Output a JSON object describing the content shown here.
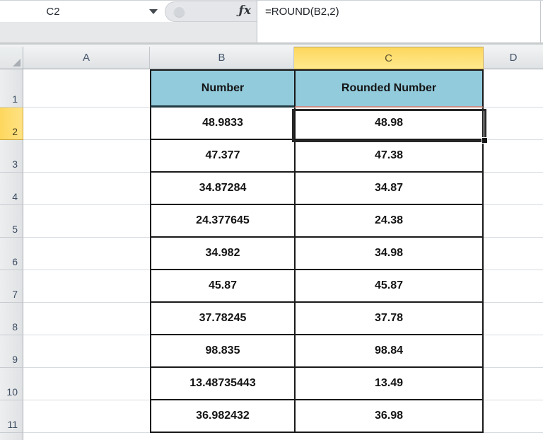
{
  "name_box": {
    "value": "C2"
  },
  "formula_bar": {
    "formula": "=ROUND(B2,2)",
    "fx": "ƒx"
  },
  "sheet": {
    "column_headers": [
      "A",
      "B",
      "C",
      "D"
    ],
    "selected_cell": "C2",
    "selected_column": "C",
    "selected_row": "2",
    "rows": [
      {
        "row": "1",
        "b": "Number",
        "c": "Rounded Number",
        "is_header": true
      },
      {
        "row": "2",
        "b": "48.9833",
        "c": "48.98",
        "selected": true
      },
      {
        "row": "3",
        "b": "47.377",
        "c": "47.38"
      },
      {
        "row": "4",
        "b": "34.87284",
        "c": "34.87"
      },
      {
        "row": "5",
        "b": "24.377645",
        "c": "24.38"
      },
      {
        "row": "6",
        "b": "34.982",
        "c": "34.98"
      },
      {
        "row": "7",
        "b": "45.87",
        "c": "45.87"
      },
      {
        "row": "8",
        "b": "37.78245",
        "c": "37.78"
      },
      {
        "row": "9",
        "b": "98.835",
        "c": "98.84"
      },
      {
        "row": "10",
        "b": "13.48735443",
        "c": "13.49"
      },
      {
        "row": "11",
        "b": "36.982432",
        "c": "36.98"
      }
    ]
  },
  "colors": {
    "selection_yellow_top": "#FDD75D",
    "selection_yellow_bottom": "#FFE98D",
    "table_header_teal": "#92CBDC",
    "table_border": "#1A1A1A",
    "selected_cell_border": "#262626",
    "grid_line": "#D8DCE1",
    "header_text": "#44546A",
    "c1_bottom_accent": "#C98E85"
  }
}
